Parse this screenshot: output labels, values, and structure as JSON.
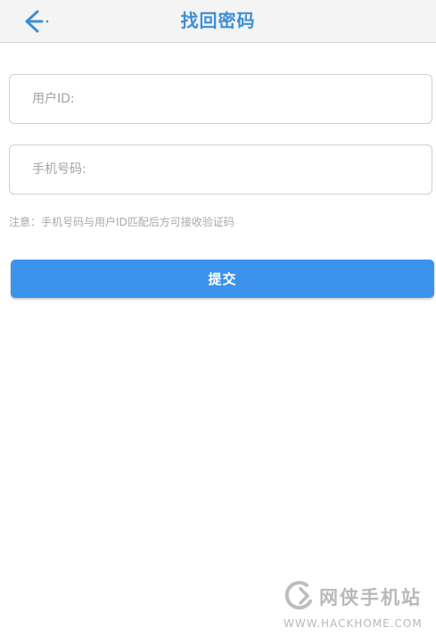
{
  "header": {
    "title": "找回密码",
    "back_icon": "arrow-left-icon",
    "title_color": "#3d8fd6"
  },
  "form": {
    "userid_placeholder": "用户ID:",
    "phone_placeholder": "手机号码:",
    "note": "注意：手机号码与用户ID匹配后方可接收验证码",
    "submit_label": "提交",
    "submit_color": "#3b93ec"
  },
  "watermark": {
    "logo_icon": "hackhome-logo-icon",
    "text": "网侠手机站",
    "url": "WWW.HACKHOME.COM"
  }
}
